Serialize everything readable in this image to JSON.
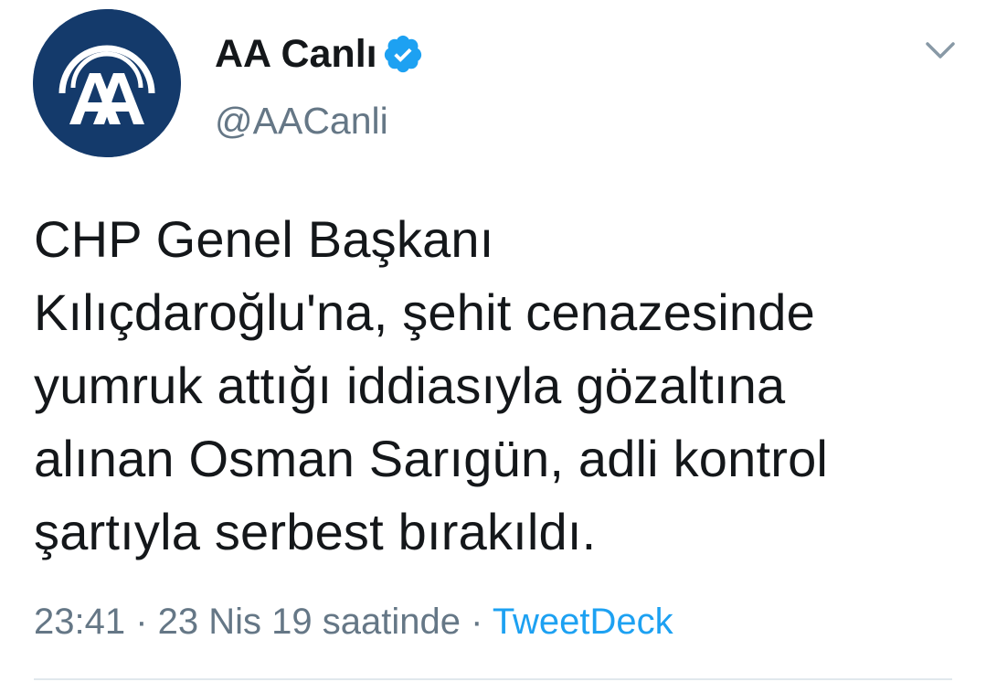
{
  "user": {
    "display_name": "AA Canlı",
    "handle": "@AACanli",
    "avatar_icon": "aa-logo-icon",
    "avatar_color": "#143a6b",
    "verified_icon": "verified-badge-icon",
    "verified_color": "#1da1f2"
  },
  "menu": {
    "icon": "chevron-down-icon"
  },
  "tweet": {
    "lines": [
      "CHP Genel Başkanı",
      "Kılıçdaroğlu'na, şehit cenazesinde",
      "yumruk attığı iddiasıyla gözaltına",
      "alınan Osman Sarıgün, adli kontrol",
      "şartıyla serbest bırakıldı."
    ]
  },
  "meta": {
    "time": "23:41",
    "separator_1": " · ",
    "date": "23 Nis 19 saatinde",
    "separator_2": " · ",
    "source": "TweetDeck",
    "source_color": "#1da1f2"
  }
}
